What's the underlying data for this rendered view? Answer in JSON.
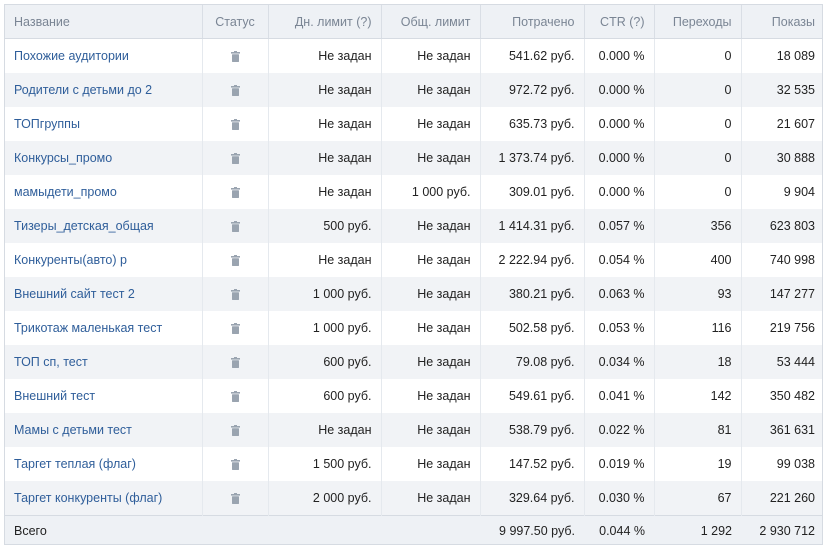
{
  "headers": {
    "name": "Название",
    "status": "Статус",
    "daily_limit": "Дн. лимит (?)",
    "total_limit": "Общ. лимит",
    "spent": "Потрачено",
    "ctr": "CTR (?)",
    "clicks": "Переходы",
    "impressions": "Показы"
  },
  "status_icon": "trash-icon",
  "rows": [
    {
      "name": "Похожие аудитории",
      "daily_limit": "Не задан",
      "total_limit": "Не задан",
      "spent": "541.62 руб.",
      "ctr": "0.000 %",
      "clicks": "0",
      "impressions": "18 089"
    },
    {
      "name": "Родители с детьми до 2",
      "daily_limit": "Не задан",
      "total_limit": "Не задан",
      "spent": "972.72 руб.",
      "ctr": "0.000 %",
      "clicks": "0",
      "impressions": "32 535"
    },
    {
      "name": "ТОПгруппы",
      "daily_limit": "Не задан",
      "total_limit": "Не задан",
      "spent": "635.73 руб.",
      "ctr": "0.000 %",
      "clicks": "0",
      "impressions": "21 607"
    },
    {
      "name": "Конкурсы_промо",
      "daily_limit": "Не задан",
      "total_limit": "Не задан",
      "spent": "1 373.74 руб.",
      "ctr": "0.000 %",
      "clicks": "0",
      "impressions": "30 888"
    },
    {
      "name": "мамыдети_промо",
      "daily_limit": "Не задан",
      "total_limit": "1 000 руб.",
      "spent": "309.01 руб.",
      "ctr": "0.000 %",
      "clicks": "0",
      "impressions": "9 904"
    },
    {
      "name": "Тизеры_детская_общая",
      "daily_limit": "500 руб.",
      "total_limit": "Не задан",
      "spent": "1 414.31 руб.",
      "ctr": "0.057 %",
      "clicks": "356",
      "impressions": "623 803"
    },
    {
      "name": "Конкуренты(авто) р",
      "daily_limit": "Не задан",
      "total_limit": "Не задан",
      "spent": "2 222.94 руб.",
      "ctr": "0.054 %",
      "clicks": "400",
      "impressions": "740 998"
    },
    {
      "name": "Внешний сайт тест 2",
      "daily_limit": "1 000 руб.",
      "total_limit": "Не задан",
      "spent": "380.21 руб.",
      "ctr": "0.063 %",
      "clicks": "93",
      "impressions": "147 277"
    },
    {
      "name": "Трикотаж маленькая тест",
      "daily_limit": "1 000 руб.",
      "total_limit": "Не задан",
      "spent": "502.58 руб.",
      "ctr": "0.053 %",
      "clicks": "116",
      "impressions": "219 756"
    },
    {
      "name": "ТОП сп, тест",
      "daily_limit": "600 руб.",
      "total_limit": "Не задан",
      "spent": "79.08 руб.",
      "ctr": "0.034 %",
      "clicks": "18",
      "impressions": "53 444"
    },
    {
      "name": "Внешний тест",
      "daily_limit": "600 руб.",
      "total_limit": "Не задан",
      "spent": "549.61 руб.",
      "ctr": "0.041 %",
      "clicks": "142",
      "impressions": "350 482"
    },
    {
      "name": "Мамы с детьми тест",
      "daily_limit": "Не задан",
      "total_limit": "Не задан",
      "spent": "538.79 руб.",
      "ctr": "0.022 %",
      "clicks": "81",
      "impressions": "361 631"
    },
    {
      "name": "Таргет теплая (флаг)",
      "daily_limit": "1 500 руб.",
      "total_limit": "Не задан",
      "spent": "147.52 руб.",
      "ctr": "0.019 %",
      "clicks": "19",
      "impressions": "99 038"
    },
    {
      "name": "Таргет конкуренты (флаг)",
      "daily_limit": "2 000 руб.",
      "total_limit": "Не задан",
      "spent": "329.64 руб.",
      "ctr": "0.030 %",
      "clicks": "67",
      "impressions": "221 260"
    }
  ],
  "totals": {
    "label": "Всего",
    "spent": "9 997.50 руб.",
    "ctr": "0.044 %",
    "clicks": "1 292",
    "impressions": "2 930 712"
  },
  "colors": {
    "link": "#2f5e9a",
    "header_bg": "#eef1f5",
    "row_alt_bg": "#f1f3f6",
    "icon": "#9aa4b0"
  }
}
